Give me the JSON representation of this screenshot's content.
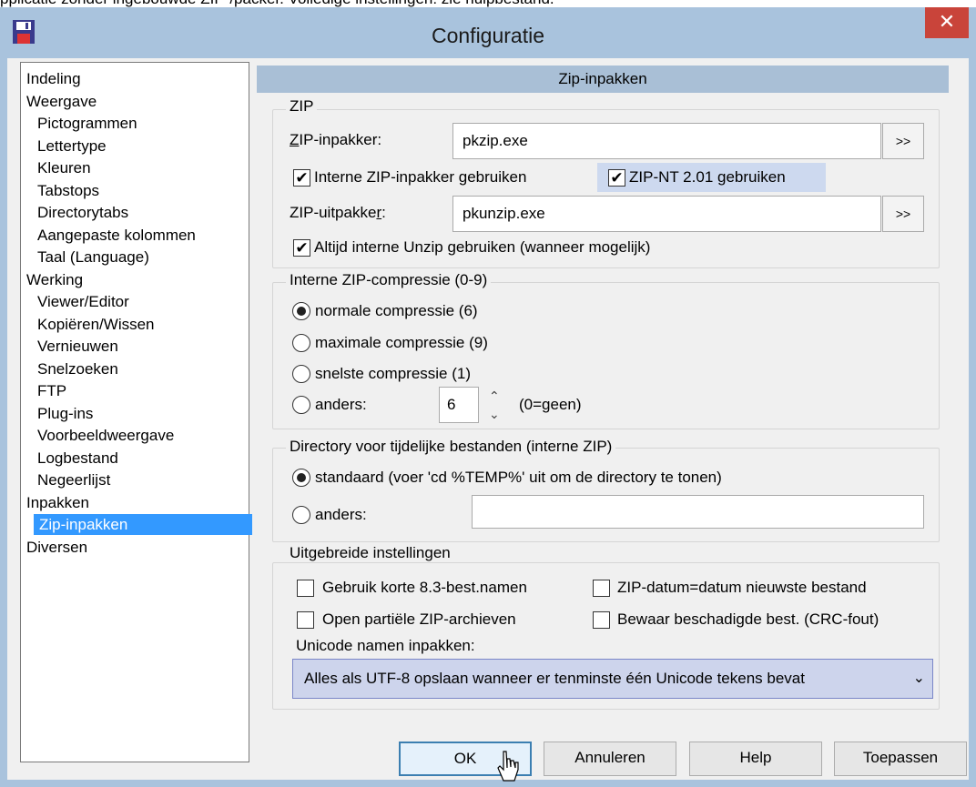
{
  "top_strip_text": "pplicatie zonder ingebouwde ZIP-/packer. Volledige instellingen: zie hulpbestand.",
  "window": {
    "title": "Configuratie",
    "close_label": "✕",
    "app_icon": "floppy-disk-icon"
  },
  "tree": {
    "items": [
      {
        "label": "Indeling",
        "level": 0
      },
      {
        "label": "Weergave",
        "level": 0
      },
      {
        "label": "Pictogrammen",
        "level": 1
      },
      {
        "label": "Lettertype",
        "level": 1
      },
      {
        "label": "Kleuren",
        "level": 1
      },
      {
        "label": "Tabstops",
        "level": 1
      },
      {
        "label": "Directorytabs",
        "level": 1
      },
      {
        "label": "Aangepaste kolommen",
        "level": 1
      },
      {
        "label": "Taal (Language)",
        "level": 1
      },
      {
        "label": "Werking",
        "level": 0
      },
      {
        "label": "Viewer/Editor",
        "level": 1
      },
      {
        "label": "Kopiëren/Wissen",
        "level": 1
      },
      {
        "label": "Vernieuwen",
        "level": 1
      },
      {
        "label": "Snelzoeken",
        "level": 1
      },
      {
        "label": "FTP",
        "level": 1
      },
      {
        "label": "Plug-ins",
        "level": 1
      },
      {
        "label": "Voorbeeldweergave",
        "level": 1
      },
      {
        "label": "Logbestand",
        "level": 1
      },
      {
        "label": "Negeerlijst",
        "level": 1
      },
      {
        "label": "Inpakken",
        "level": 0
      },
      {
        "label": "Zip-inpakken",
        "level": 1,
        "selected": true
      },
      {
        "label": "Diversen",
        "level": 0
      }
    ]
  },
  "pane_title": "Zip-inpakken",
  "zip": {
    "legend": "ZIP",
    "packer_label_u": "Z",
    "packer_label_rest": "IP-inpakker:",
    "packer_value": "pkzip.exe",
    "browse_label": ">>",
    "internal_packer": "Interne ZIP-inpakker gebruiken",
    "zip_nt": "ZIP-NT 2.01 gebruiken",
    "unpacker_label_a": "ZIP-uitpakke",
    "unpacker_label_u": "r",
    "unpacker_label_b": ":",
    "unpacker_value": "pkunzip.exe",
    "always_internal_unzip": "Altijd interne Unzip gebruiken (wanneer mogelijk)"
  },
  "compression": {
    "legend": "Interne ZIP-compressie (0-9)",
    "normal": "normale compressie (6)",
    "max": "maximale compressie (9)",
    "fastest": "snelste compressie (1)",
    "other": "anders:",
    "other_value": "6",
    "hint": "(0=geen)",
    "selected": "normal"
  },
  "tempdir": {
    "legend": "Directory voor tijdelijke bestanden (interne ZIP)",
    "standard": "standaard (voer 'cd %TEMP%' uit om de directory te tonen)",
    "other": "anders:",
    "other_value": ""
  },
  "advanced": {
    "legend": "Uitgebreide instellingen",
    "short_names": "Gebruik korte 8.3-best.namen",
    "zip_date": "ZIP-datum=datum nieuwste bestand",
    "open_partial": "Open partiële ZIP-archieven",
    "keep_damaged": "Bewaar beschadigde best. (CRC-fout)",
    "unicode_label": "Unicode namen inpakken:",
    "unicode_value": "Alles als UTF-8 opslaan wanneer er tenminste één Unicode tekens bevat"
  },
  "buttons": {
    "ok": "OK",
    "cancel": "Annuleren",
    "help": "Help",
    "apply": "Toepassen"
  },
  "colors": {
    "titlebar": "#a9c3dd",
    "close": "#c9443a",
    "selection": "#3399ff",
    "pane_header": "#a9bfd6"
  }
}
